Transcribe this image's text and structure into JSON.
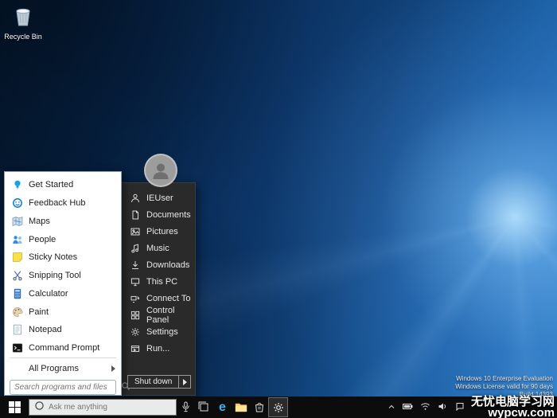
{
  "colors": {
    "taskbar_bg": "#0c0c0c",
    "start_left_bg": "#ffffff",
    "start_right_bg": "#2a2a2a",
    "accent_blue": "#0f7ad8",
    "edge_blue": "#3fb0e8"
  },
  "desktop": {
    "recycle_bin_label": "Recycle Bin",
    "eval": {
      "line1": "Windows 10 Enterprise Evaluation",
      "line2": "Windows License valid for 90 days",
      "line3": "Build 14393"
    },
    "watermark": {
      "line1": "无忧电脑学习网",
      "line2": "wypcw.com"
    }
  },
  "start_menu": {
    "left_items": [
      {
        "label": "Get Started",
        "icon": "lightbulb-icon"
      },
      {
        "label": "Feedback Hub",
        "icon": "feedback-smiley-icon"
      },
      {
        "label": "Maps",
        "icon": "map-icon"
      },
      {
        "label": "People",
        "icon": "people-icon"
      },
      {
        "label": "Sticky Notes",
        "icon": "sticky-note-icon"
      },
      {
        "label": "Snipping Tool",
        "icon": "scissors-icon"
      },
      {
        "label": "Calculator",
        "icon": "calculator-icon"
      },
      {
        "label": "Paint",
        "icon": "paint-palette-icon"
      },
      {
        "label": "Notepad",
        "icon": "notepad-icon"
      },
      {
        "label": "Command Prompt",
        "icon": "terminal-icon"
      }
    ],
    "all_programs_label": "All Programs",
    "search_placeholder": "Search programs and files",
    "right_items": [
      {
        "label": "IEUser",
        "icon": "user-icon"
      },
      {
        "label": "Documents",
        "icon": "document-icon"
      },
      {
        "label": "Pictures",
        "icon": "picture-icon"
      },
      {
        "label": "Music",
        "icon": "music-note-icon"
      },
      {
        "label": "Downloads",
        "icon": "download-arrow-icon"
      },
      {
        "label": "This PC",
        "icon": "computer-icon"
      },
      {
        "label": "Connect To",
        "icon": "connect-icon"
      },
      {
        "label": "Control Panel",
        "icon": "control-panel-icon"
      },
      {
        "label": "Settings",
        "icon": "gear-icon"
      },
      {
        "label": "Run...",
        "icon": "run-icon"
      }
    ],
    "shutdown_label": "Shut down"
  },
  "taskbar": {
    "search_placeholder": "Ask me anything",
    "edge_glyph": "e"
  }
}
